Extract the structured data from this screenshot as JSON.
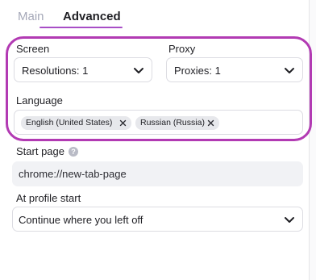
{
  "tabs": {
    "main": "Main",
    "advanced": "Advanced"
  },
  "screen": {
    "label": "Screen",
    "value": "Resolutions: 1"
  },
  "proxy": {
    "label": "Proxy",
    "value": "Proxies: 1"
  },
  "language": {
    "label": "Language",
    "tags": [
      "English (United States)",
      "Russian (Russia)"
    ]
  },
  "start_page": {
    "label": "Start page",
    "help_icon": "question-mark-icon",
    "value": "chrome://new-tab-page"
  },
  "profile_start": {
    "label": "At profile start",
    "value": "Continue where you left off"
  },
  "colors": {
    "accent": "#a84ec6",
    "highlight_ring": "#b23ab3",
    "tab_inactive": "#a5a8b8",
    "tag_bg": "#e7e8ec",
    "input_bg": "#f1f2f5"
  }
}
